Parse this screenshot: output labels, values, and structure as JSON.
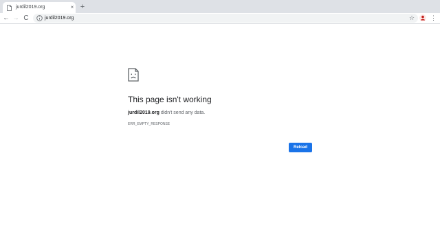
{
  "tab": {
    "title": "jurdil2019.org",
    "close": "×"
  },
  "new_tab": "+",
  "toolbar": {
    "back": "←",
    "forward": "→",
    "reload": "C",
    "url": "jurdil2019.org",
    "star": "☆",
    "menu": "⋮"
  },
  "error": {
    "title": "This page isn't working",
    "host": "jurdil2019.org",
    "message": " didn't send any data.",
    "code": "ERR_EMPTY_RESPONSE",
    "reload_label": "Reload"
  },
  "colors": {
    "accent": "#1a73e8",
    "tabstrip": "#dee1e6",
    "omnibox": "#f1f3f4"
  },
  "icons": {
    "favicon": "document-icon",
    "info": "info-icon",
    "star": "star-icon",
    "profile": "profile-icon",
    "menu": "kebab-menu-icon",
    "sad_page": "sad-page-icon"
  }
}
